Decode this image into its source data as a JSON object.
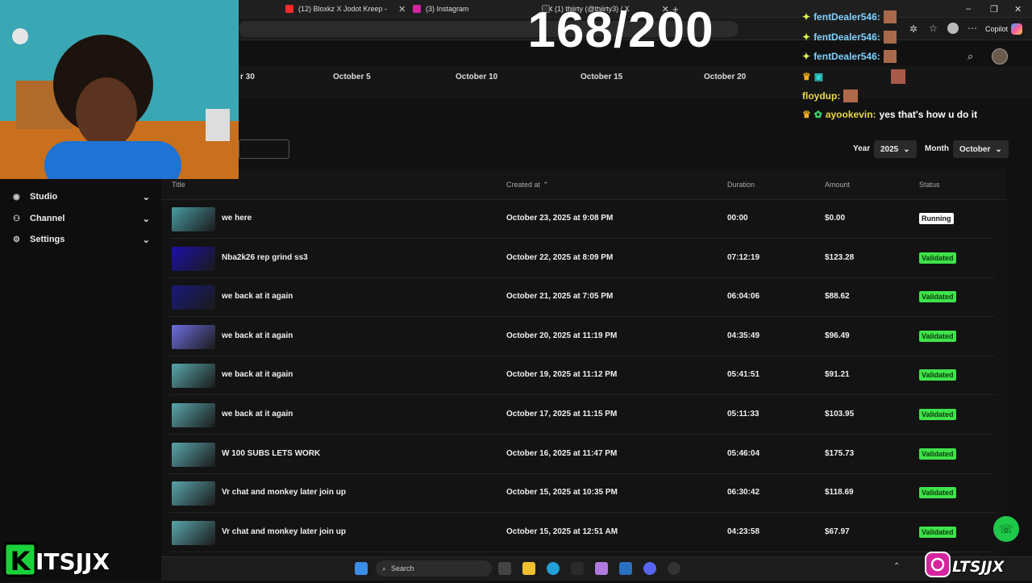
{
  "browser": {
    "tabs": [
      {
        "label": "(12) Bloxkz X Jodot Kreep - ",
        "color": "#ff2a2a"
      },
      {
        "label": "(3) Instagram",
        "color": "#d6249f"
      },
      {
        "label": "(1) thiirty (@thiirty3) / X",
        "color": "#222222"
      }
    ],
    "copilot": "Copilot",
    "window_controls": [
      "–",
      "❐",
      "✕"
    ]
  },
  "stream_counter": "168/200",
  "timeline": {
    "labels": [
      "r 30",
      "October 5",
      "October 10",
      "October 15",
      "October 20"
    ]
  },
  "filters": {
    "year_label": "Year",
    "year_value": "2025",
    "month_label": "Month",
    "month_value": "October"
  },
  "sidebar": {
    "items": [
      {
        "label": "Studio",
        "icon": "studio-icon"
      },
      {
        "label": "Channel",
        "icon": "channel-icon"
      },
      {
        "label": "Settings",
        "icon": "gear-icon"
      }
    ]
  },
  "table": {
    "headers": {
      "title": "Title",
      "created": "Created at",
      "duration": "Duration",
      "amount": "Amount",
      "status": "Status"
    },
    "rows": [
      {
        "title": "we here",
        "created": "October 23, 2025 at 9:08 PM",
        "duration": "00:00",
        "amount": "$0.00",
        "status": "Running",
        "thumb": "#4a9aa4"
      },
      {
        "title": "Nba2k26 rep grind ss3",
        "created": "October 22, 2025 at 8:09 PM",
        "duration": "07:12:19",
        "amount": "$123.28",
        "status": "Validated",
        "thumb": "#1c10a8"
      },
      {
        "title": "we back at it again",
        "created": "October 21, 2025 at 7:05 PM",
        "duration": "06:04:06",
        "amount": "$88.62",
        "status": "Validated",
        "thumb": "#1a1a7a"
      },
      {
        "title": "we back at it again",
        "created": "October 20, 2025 at 11:19 PM",
        "duration": "04:35:49",
        "amount": "$96.49",
        "status": "Validated",
        "thumb": "#6e6ee0"
      },
      {
        "title": "we back at it again",
        "created": "October 19, 2025 at 11:12 PM",
        "duration": "05:41:51",
        "amount": "$91.21",
        "status": "Validated",
        "thumb": "#5aa6ac"
      },
      {
        "title": "we back at it again",
        "created": "October 17, 2025 at 11:15 PM",
        "duration": "05:11:33",
        "amount": "$103.95",
        "status": "Validated",
        "thumb": "#5aa6ac"
      },
      {
        "title": "W 100 SUBS LETS WORK",
        "created": "October 16, 2025 at 11:47 PM",
        "duration": "05:46:04",
        "amount": "$175.73",
        "status": "Validated",
        "thumb": "#5aa6ac"
      },
      {
        "title": "Vr chat and monkey later join up",
        "created": "October 15, 2025 at 10:35 PM",
        "duration": "06:30:42",
        "amount": "$118.69",
        "status": "Validated",
        "thumb": "#5aa6ac"
      },
      {
        "title": "Vr chat and monkey later join up",
        "created": "October 15, 2025 at 12:51 AM",
        "duration": "04:23:58",
        "amount": "$67.97",
        "status": "Validated",
        "thumb": "#5aa6ac"
      }
    ]
  },
  "chat": [
    {
      "user": "fentDealer546:",
      "message": "",
      "color": "#7fd0ff"
    },
    {
      "user": "fentDealer546:",
      "message": "",
      "color": "#7fd0ff"
    },
    {
      "user": "fentDealer546:",
      "message": "",
      "color": "#7fd0ff"
    },
    {
      "user": "floydup:",
      "message": "",
      "color": "#e8d84a"
    },
    {
      "user": "ayookevin:",
      "message": "yes that's how u do it",
      "color": "#e8d84a"
    }
  ],
  "watermark_left": "KITSJJX",
  "watermark_right": "LTSJJX",
  "taskbar": {
    "search_placeholder": "Search"
  }
}
